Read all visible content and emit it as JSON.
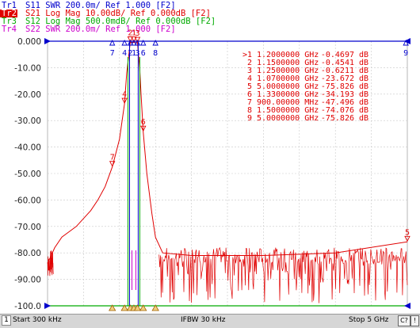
{
  "traces": [
    {
      "label": "Tr1",
      "param": "S11",
      "format": "SWR",
      "scale": "200.0m/",
      "ref": "Ref 1.000",
      "tag": "[F2]",
      "color": "#0000cc",
      "active": false
    },
    {
      "label": "Tr2",
      "param": "S21",
      "format": "Log Mag",
      "scale": "10.00dB/",
      "ref": "Ref 0.000dB",
      "tag": "[F2]",
      "color": "#e00000",
      "active": true
    },
    {
      "label": "Tr3",
      "param": "S12",
      "format": "Log Mag",
      "scale": "500.0mdB/",
      "ref": "Ref 0.000dB",
      "tag": "[F2]",
      "color": "#00aa00",
      "active": false
    },
    {
      "label": "Tr4",
      "param": "S22",
      "format": "SWR",
      "scale": "200.0m/",
      "ref": "Ref 1.000",
      "tag": "[F2]",
      "color": "#cc00cc",
      "active": false
    }
  ],
  "y_ticks": [
    "0.000",
    "-10.00",
    "-20.00",
    "-30.00",
    "-40.00",
    "-50.00",
    "-60.00",
    "-70.00",
    "-80.00",
    "-90.00",
    "-100.0"
  ],
  "markers": [
    {
      "num": ">1",
      "freq": "1.2000000 GHz",
      "val": "-0.4697",
      "unit": "dB"
    },
    {
      "num": "2",
      "freq": "1.1500000 GHz",
      "val": "-0.4541",
      "unit": "dB"
    },
    {
      "num": "3",
      "freq": "1.2500000 GHz",
      "val": "-0.6211",
      "unit": "dB"
    },
    {
      "num": "4",
      "freq": "1.0700000 GHz",
      "val": "-23.672",
      "unit": "dB"
    },
    {
      "num": "5",
      "freq": "5.0000000 GHz",
      "val": "-75.826",
      "unit": "dB"
    },
    {
      "num": "6",
      "freq": "1.3300000 GHz",
      "val": "-34.193",
      "unit": "dB"
    },
    {
      "num": "7",
      "freq": "900.00000 MHz",
      "val": "-47.496",
      "unit": "dB"
    },
    {
      "num": "8",
      "freq": "1.5000000 GHz",
      "val": "-74.076",
      "unit": "dB"
    },
    {
      "num": "9",
      "freq": "5.0000000 GHz",
      "val": "-75.826",
      "unit": "dB"
    }
  ],
  "top_marker_labels": [
    "7",
    "4",
    "2",
    "1",
    "3",
    "6",
    "8",
    "9"
  ],
  "status": {
    "channel": "1",
    "start": "Start 300 kHz",
    "ifbw": "IFBW 30 kHz",
    "stop": "Stop 5 GHz",
    "c_button": "C?",
    "exclaim": "!"
  },
  "chart_data": {
    "type": "line",
    "x_range_hz": [
      300000,
      5000000000
    ],
    "ylim": [
      -100,
      0
    ],
    "y_unit": "dB",
    "grid": true,
    "series": [
      {
        "name": "S21",
        "color": "#e00000",
        "x_ghz": [
          0.0003,
          0.1,
          0.2,
          0.3,
          0.4,
          0.5,
          0.6,
          0.7,
          0.8,
          0.9,
          1.0,
          1.07,
          1.1,
          1.15,
          1.2,
          1.25,
          1.28,
          1.3,
          1.33,
          1.38,
          1.45,
          1.5,
          1.6,
          2.0,
          3.0,
          4.0,
          5.0
        ],
        "y_db": [
          -84,
          -78,
          -74,
          -72,
          -70,
          -67,
          -64,
          -60,
          -55,
          -47.5,
          -37,
          -23.7,
          -12,
          -0.45,
          -0.47,
          -0.62,
          -10,
          -20,
          -34.2,
          -50,
          -65,
          -74.1,
          -80,
          -81,
          -81,
          -80,
          -75.8
        ]
      }
    ]
  }
}
